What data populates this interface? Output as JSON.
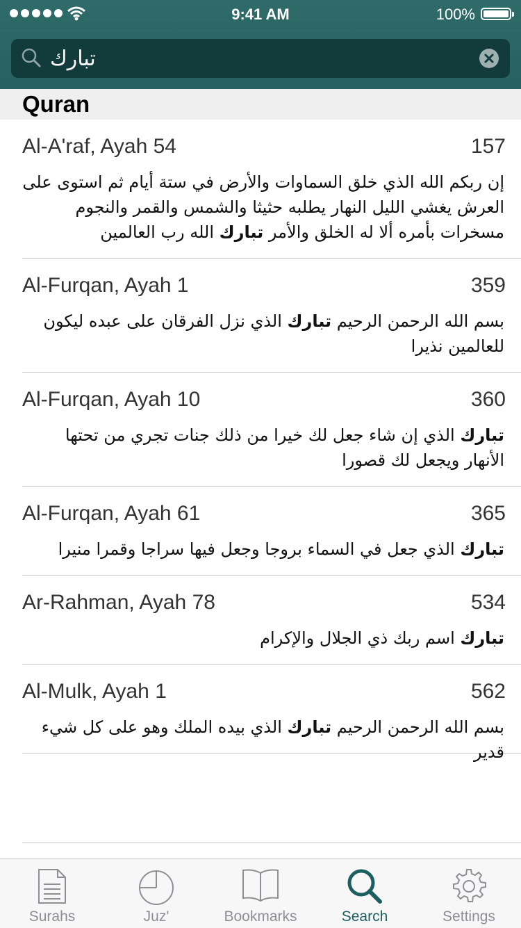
{
  "status_bar": {
    "time": "9:41 AM",
    "battery": "100%"
  },
  "search": {
    "value": "تبارك",
    "placeholder": ""
  },
  "section": {
    "title": "Quran"
  },
  "results": [
    {
      "ref": "Al-A'raf, Ayah 54",
      "page": "157",
      "segments": [
        {
          "t": "إن ربكم الله الذي خلق السماوات والأرض في ستة أيام ثم استوى على العرش يغشي الليل النهار يطلبه حثيثا والشمس والقمر والنجوم مسخرات بأمره ألا له الخلق والأمر ",
          "b": false
        },
        {
          "t": "تبارك",
          "b": true
        },
        {
          "t": " الله رب العالمين",
          "b": false
        }
      ]
    },
    {
      "ref": "Al-Furqan, Ayah 1",
      "page": "359",
      "segments": [
        {
          "t": "بسم الله الرحمن الرحيم ",
          "b": false
        },
        {
          "t": "تبارك",
          "b": true
        },
        {
          "t": " الذي نزل الفرقان على عبده ليكون للعالمين نذيرا",
          "b": false
        }
      ]
    },
    {
      "ref": "Al-Furqan, Ayah 10",
      "page": "360",
      "segments": [
        {
          "t": "تبارك",
          "b": true
        },
        {
          "t": " الذي إن شاء جعل لك خيرا من ذلك جنات تجري من تحتها الأنهار ويجعل لك قصورا",
          "b": false
        }
      ]
    },
    {
      "ref": "Al-Furqan, Ayah 61",
      "page": "365",
      "segments": [
        {
          "t": "تبارك",
          "b": true
        },
        {
          "t": " الذي جعل في السماء بروجا وجعل فيها سراجا وقمرا منيرا",
          "b": false
        }
      ]
    },
    {
      "ref": "Ar-Rahman, Ayah 78",
      "page": "534",
      "segments": [
        {
          "t": "تبارك",
          "b": true
        },
        {
          "t": " اسم ربك ذي الجلال والإكرام",
          "b": false
        }
      ]
    },
    {
      "ref": "Al-Mulk, Ayah 1",
      "page": "562",
      "segments": [
        {
          "t": "بسم الله الرحمن الرحيم ",
          "b": false
        },
        {
          "t": "تبارك",
          "b": true
        },
        {
          "t": " الذي بيده الملك وهو على كل شيء قدير",
          "b": false
        }
      ]
    }
  ],
  "tabs": [
    {
      "label": "Surahs",
      "icon": "document-icon"
    },
    {
      "label": "Juz'",
      "icon": "pie-icon"
    },
    {
      "label": "Bookmarks",
      "icon": "book-icon"
    },
    {
      "label": "Search",
      "icon": "search-icon",
      "active": true
    },
    {
      "label": "Settings",
      "icon": "gear-icon"
    }
  ],
  "colors": {
    "header": "#2e6b69",
    "search_field": "#123b3c",
    "active_tab": "#1d5f60",
    "inactive_tab": "#8e8e93"
  }
}
